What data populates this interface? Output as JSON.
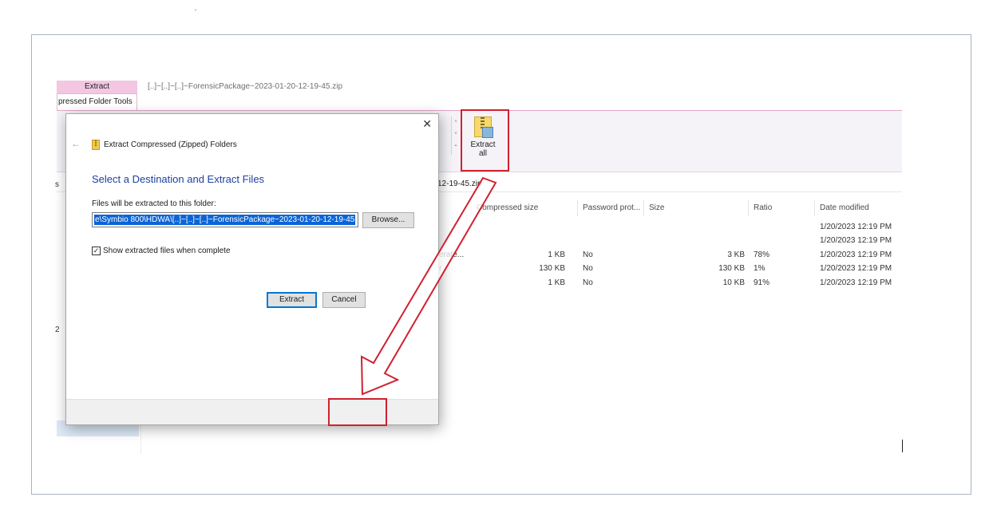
{
  "explorer": {
    "context_tab_head": "Extract",
    "context_tab": "pressed Folder Tools",
    "window_title": "[..]~[..]~[..]~ForensicPackage~2023-01-20-12-19-45.zip",
    "ribbon": {
      "extract_all_line1": "Extract",
      "extract_all_line2": "all",
      "scroll_up": "˄",
      "scroll_dn": "˅",
      "scroll_more": "⩡"
    },
    "address_fragment": "12-19-45.zip",
    "left_fragment_1": "s",
    "left_fragment_2": "2",
    "columns": {
      "compressed_size": "Compressed size",
      "password": "Password prot...",
      "size": "Size",
      "ratio": "Ratio",
      "date_modified": "Date modified"
    },
    "rows": [
      {
        "name": "",
        "compressed": "",
        "password": "",
        "size": "",
        "ratio": "",
        "date": "1/20/2023 12:19 PM"
      },
      {
        "name": "",
        "compressed": "",
        "password": "",
        "size": "",
        "ratio": "",
        "date": "1/20/2023 12:19 PM"
      },
      {
        "name": "erate...",
        "compressed": "1 KB",
        "password": "No",
        "size": "3 KB",
        "ratio": "78%",
        "date": "1/20/2023 12:19 PM"
      },
      {
        "name": "r",
        "compressed": "130 KB",
        "password": "No",
        "size": "130 KB",
        "ratio": "1%",
        "date": "1/20/2023 12:19 PM"
      },
      {
        "name": "",
        "compressed": "1 KB",
        "password": "No",
        "size": "10 KB",
        "ratio": "91%",
        "date": "1/20/2023 12:19 PM"
      }
    ]
  },
  "dialog": {
    "close": "✕",
    "back": "←",
    "title": "Extract Compressed (Zipped) Folders",
    "heading": "Select a Destination and Extract Files",
    "label": "Files will be extracted to this folder:",
    "path_value": "e\\Symbio 800\\HDWA\\[..]~[..]~[..]~ForensicPackage~2023-01-20-12-19-45",
    "browse": "Browse...",
    "checkbox_checked": "✓",
    "checkbox_label": "Show extracted files when complete",
    "extract_button": "Extract",
    "cancel_button": "Cancel"
  },
  "colors": {
    "highlight_red": "#d0212f",
    "heading_blue": "#1f3e9f",
    "selection_blue": "#0a64d6",
    "context_pink": "#f3c6e2"
  }
}
